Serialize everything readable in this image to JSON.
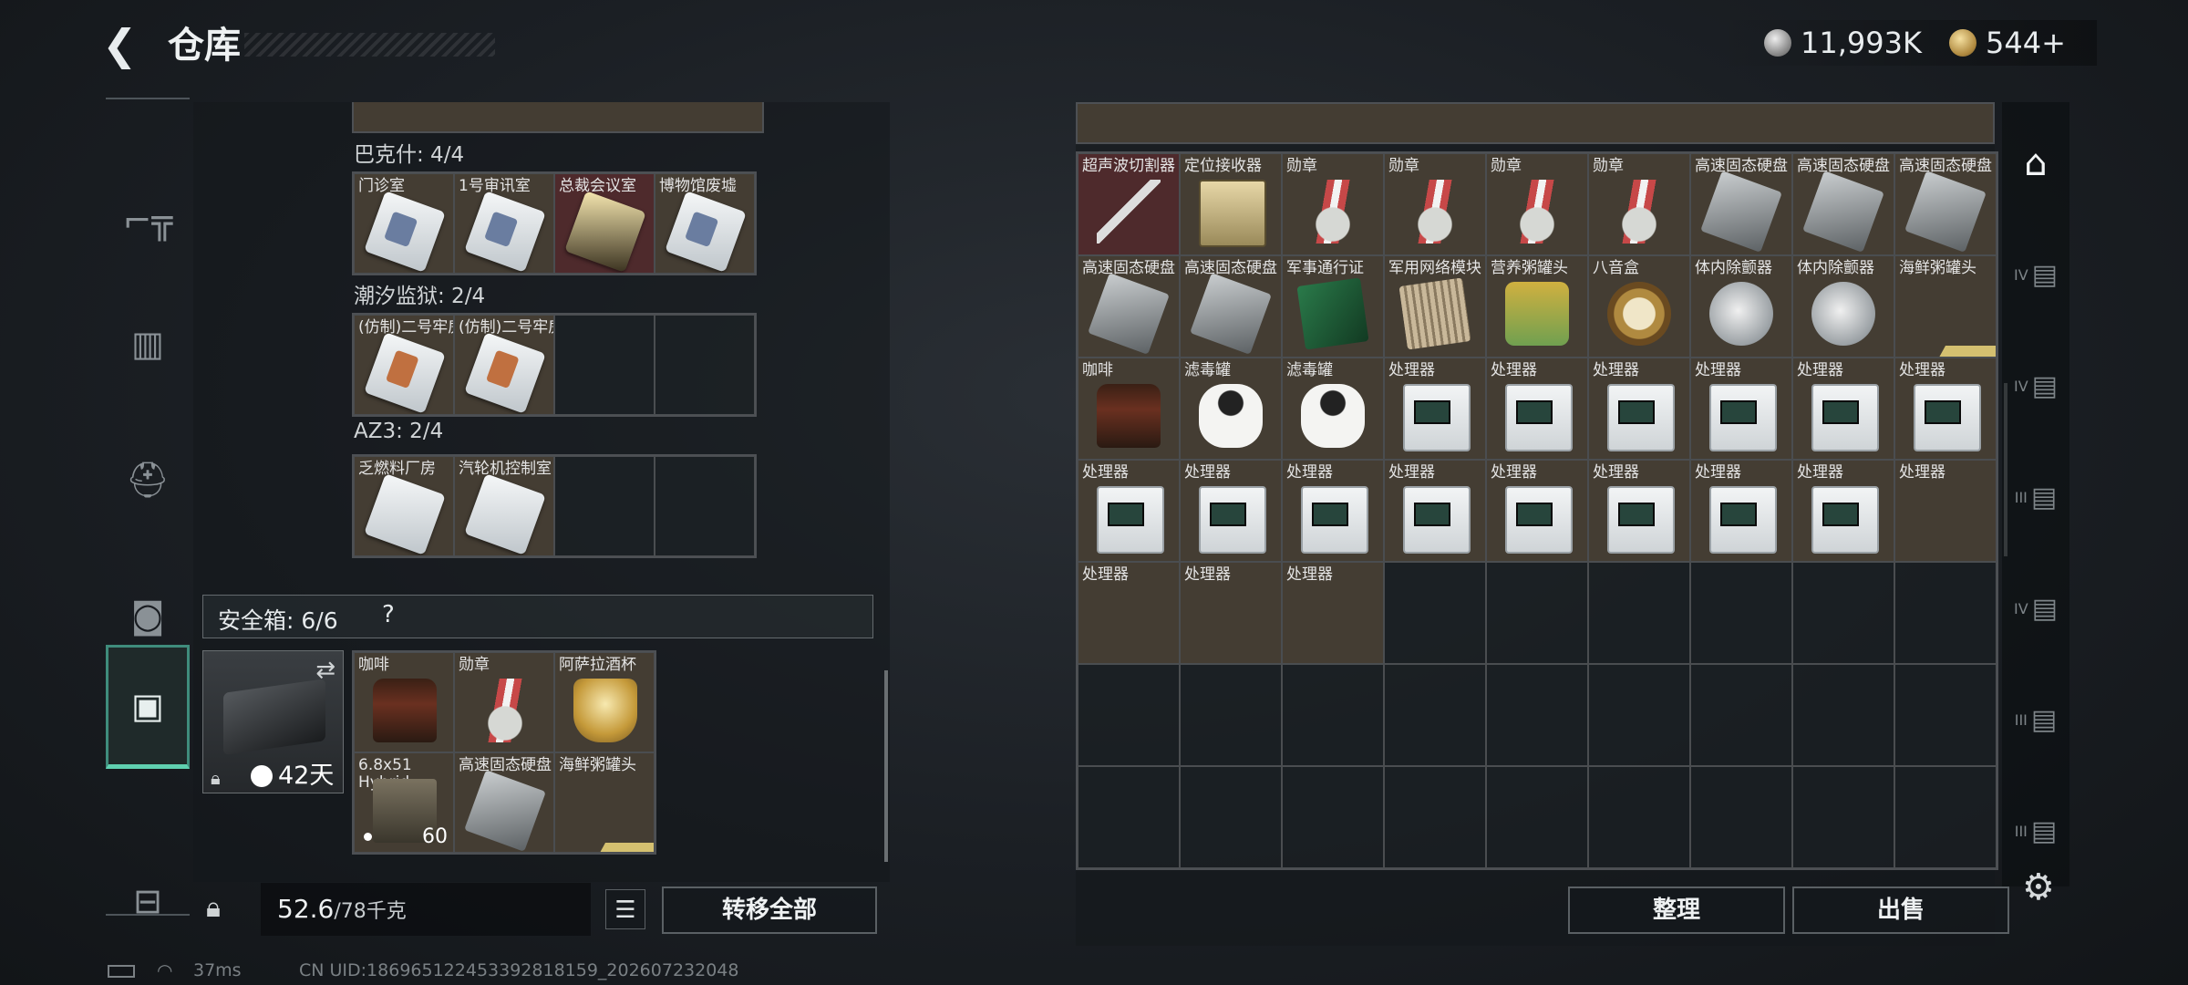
{
  "header": {
    "back_icon": "back-chevron-icon",
    "title": "仓库",
    "silver_icon": "silver-coin-icon",
    "silver_amount": "11,993K",
    "gold_icon": "gold-coin-icon",
    "gold_amount": "544",
    "gold_add": "+"
  },
  "sidenav": [
    "gun-icon",
    "armor-vest-icon",
    "rig-icon",
    "backpack-icon",
    "safe-box-icon",
    "toolbox-icon"
  ],
  "groups": [
    {
      "label": "巴克什: 4/4",
      "items": [
        {
          "name": "门诊室",
          "art": "card blue",
          "bg": "normal"
        },
        {
          "name": "1号审讯室",
          "art": "card blue",
          "bg": "normal"
        },
        {
          "name": "总裁会议室",
          "art": "card gold",
          "bg": "red"
        },
        {
          "name": "博物馆废墟",
          "art": "card blue",
          "bg": "normal"
        }
      ]
    },
    {
      "label": "潮汐监狱: 2/4",
      "items": [
        {
          "name": "(仿制)二号牢房",
          "art": "card orange",
          "bg": "normal"
        },
        {
          "name": "(仿制)二号牢房",
          "art": "card orange",
          "bg": "normal"
        },
        {
          "name": "",
          "art": "",
          "bg": "empty"
        },
        {
          "name": "",
          "art": "",
          "bg": "empty"
        }
      ]
    },
    {
      "label": "AZ3: 2/4",
      "items": [
        {
          "name": "乏燃料厂房",
          "art": "card",
          "bg": "normal"
        },
        {
          "name": "汽轮机控制室",
          "art": "card",
          "bg": "normal"
        },
        {
          "name": "",
          "art": "",
          "bg": "empty"
        },
        {
          "name": "",
          "art": "",
          "bg": "empty"
        }
      ]
    }
  ],
  "safebox": {
    "title": "安全箱: 6/6",
    "help": "?",
    "days": "42天",
    "swap_icon": "swap-icon",
    "lock_icon": "lock-icon",
    "clock_icon": "clock-icon",
    "items": [
      {
        "name": "咖啡",
        "art": "coffee"
      },
      {
        "name": "勋章",
        "art": "medal"
      },
      {
        "name": "阿萨拉酒杯",
        "art": "cup"
      },
      {
        "name": "6.8x51",
        "name2": "Hybrid",
        "art": "ammo",
        "qty": "60"
      },
      {
        "name": "高速固态硬盘",
        "art": "ssd"
      },
      {
        "name": "海鲜粥罐头",
        "art": "fish"
      }
    ]
  },
  "bottom_left": {
    "weight": "52.6",
    "weight_max": "/78千克",
    "list_icon": "list-icon",
    "transfer_label": "转移全部"
  },
  "storage": {
    "rows": [
      [
        {
          "name": "超声波切割器",
          "art": "pen",
          "bg": "red"
        },
        {
          "name": "定位接收器",
          "art": "gps",
          "bg": "normal"
        },
        {
          "name": "勋章",
          "art": "medal",
          "bg": "normal"
        },
        {
          "name": "勋章",
          "art": "medal",
          "bg": "normal"
        },
        {
          "name": "勋章",
          "art": "medal",
          "bg": "normal"
        },
        {
          "name": "勋章",
          "art": "medal",
          "bg": "normal"
        },
        {
          "name": "高速固态硬盘",
          "art": "ssd",
          "bg": "normal"
        },
        {
          "name": "高速固态硬盘",
          "art": "ssd",
          "bg": "normal"
        },
        {
          "name": "高速固态硬盘",
          "art": "ssd",
          "bg": "normal"
        }
      ],
      [
        {
          "name": "高速固态硬盘",
          "art": "ssd",
          "bg": "normal"
        },
        {
          "name": "高速固态硬盘",
          "art": "ssd",
          "bg": "normal"
        },
        {
          "name": "军事通行证",
          "art": "book",
          "bg": "normal"
        },
        {
          "name": "军用网络模块",
          "art": "net",
          "bg": "normal"
        },
        {
          "name": "营养粥罐头",
          "art": "tin",
          "bg": "normal"
        },
        {
          "name": "八音盒",
          "art": "musicbox",
          "bg": "normal"
        },
        {
          "name": "体内除颤器",
          "art": "disc",
          "bg": "normal"
        },
        {
          "name": "体内除颤器",
          "art": "disc",
          "bg": "normal"
        },
        {
          "name": "海鲜粥罐头",
          "art": "fish",
          "bg": "normal"
        }
      ],
      [
        {
          "name": "咖啡",
          "art": "coffee",
          "bg": "normal"
        },
        {
          "name": "滤毒罐",
          "art": "filter",
          "bg": "normal"
        },
        {
          "name": "滤毒罐",
          "art": "filter",
          "bg": "normal"
        },
        {
          "name": "处理器",
          "art": "proc",
          "bg": "normal"
        },
        {
          "name": "处理器",
          "art": "proc",
          "bg": "normal"
        },
        {
          "name": "处理器",
          "art": "proc",
          "bg": "normal"
        },
        {
          "name": "处理器",
          "art": "proc",
          "bg": "normal"
        },
        {
          "name": "处理器",
          "art": "proc",
          "bg": "normal"
        },
        {
          "name": "处理器",
          "art": "proc",
          "bg": "normal"
        }
      ],
      [
        {
          "name": "处理器",
          "art": "proc",
          "bg": "normal"
        },
        {
          "name": "处理器",
          "art": "proc",
          "bg": "normal"
        },
        {
          "name": "处理器",
          "art": "proc",
          "bg": "normal"
        },
        {
          "name": "处理器",
          "art": "proc",
          "bg": "normal"
        },
        {
          "name": "处理器",
          "art": "proc",
          "bg": "normal"
        },
        {
          "name": "处理器",
          "art": "proc",
          "bg": "normal"
        },
        {
          "name": "处理器",
          "art": "proc",
          "bg": "normal"
        },
        {
          "name": "处理器",
          "art": "proc",
          "bg": "normal"
        },
        {
          "name": "处理器",
          "art": "",
          "bg": "normal"
        }
      ],
      [
        {
          "name": "处理器",
          "art": "",
          "bg": "normal"
        },
        {
          "name": "处理器",
          "art": "",
          "bg": "normal"
        },
        {
          "name": "处理器",
          "art": "",
          "bg": "normal"
        },
        {
          "name": "",
          "art": "",
          "bg": "empty"
        },
        {
          "name": "",
          "art": "",
          "bg": "empty"
        },
        {
          "name": "",
          "art": "",
          "bg": "empty"
        },
        {
          "name": "",
          "art": "",
          "bg": "empty"
        },
        {
          "name": "",
          "art": "",
          "bg": "empty"
        },
        {
          "name": "",
          "art": "",
          "bg": "empty"
        }
      ]
    ],
    "sort_label": "整理",
    "sell_label": "出售"
  },
  "rail": [
    {
      "icon": "home-icon",
      "tier": ""
    },
    {
      "icon": "weapon-filter-icon",
      "tier": "IV"
    },
    {
      "icon": "weapon-filter-icon",
      "tier": "IV"
    },
    {
      "icon": "weapon-filter-icon",
      "tier": "III"
    },
    {
      "icon": "weapon-filter-icon",
      "tier": "IV"
    },
    {
      "icon": "weapon-filter-icon",
      "tier": "III"
    },
    {
      "icon": "weapon-filter-icon",
      "tier": "III"
    }
  ],
  "settings_icon": "gear-icon",
  "footer": {
    "ping": "37ms",
    "uid": "CN UID:186965122453392818159_202607232048"
  }
}
